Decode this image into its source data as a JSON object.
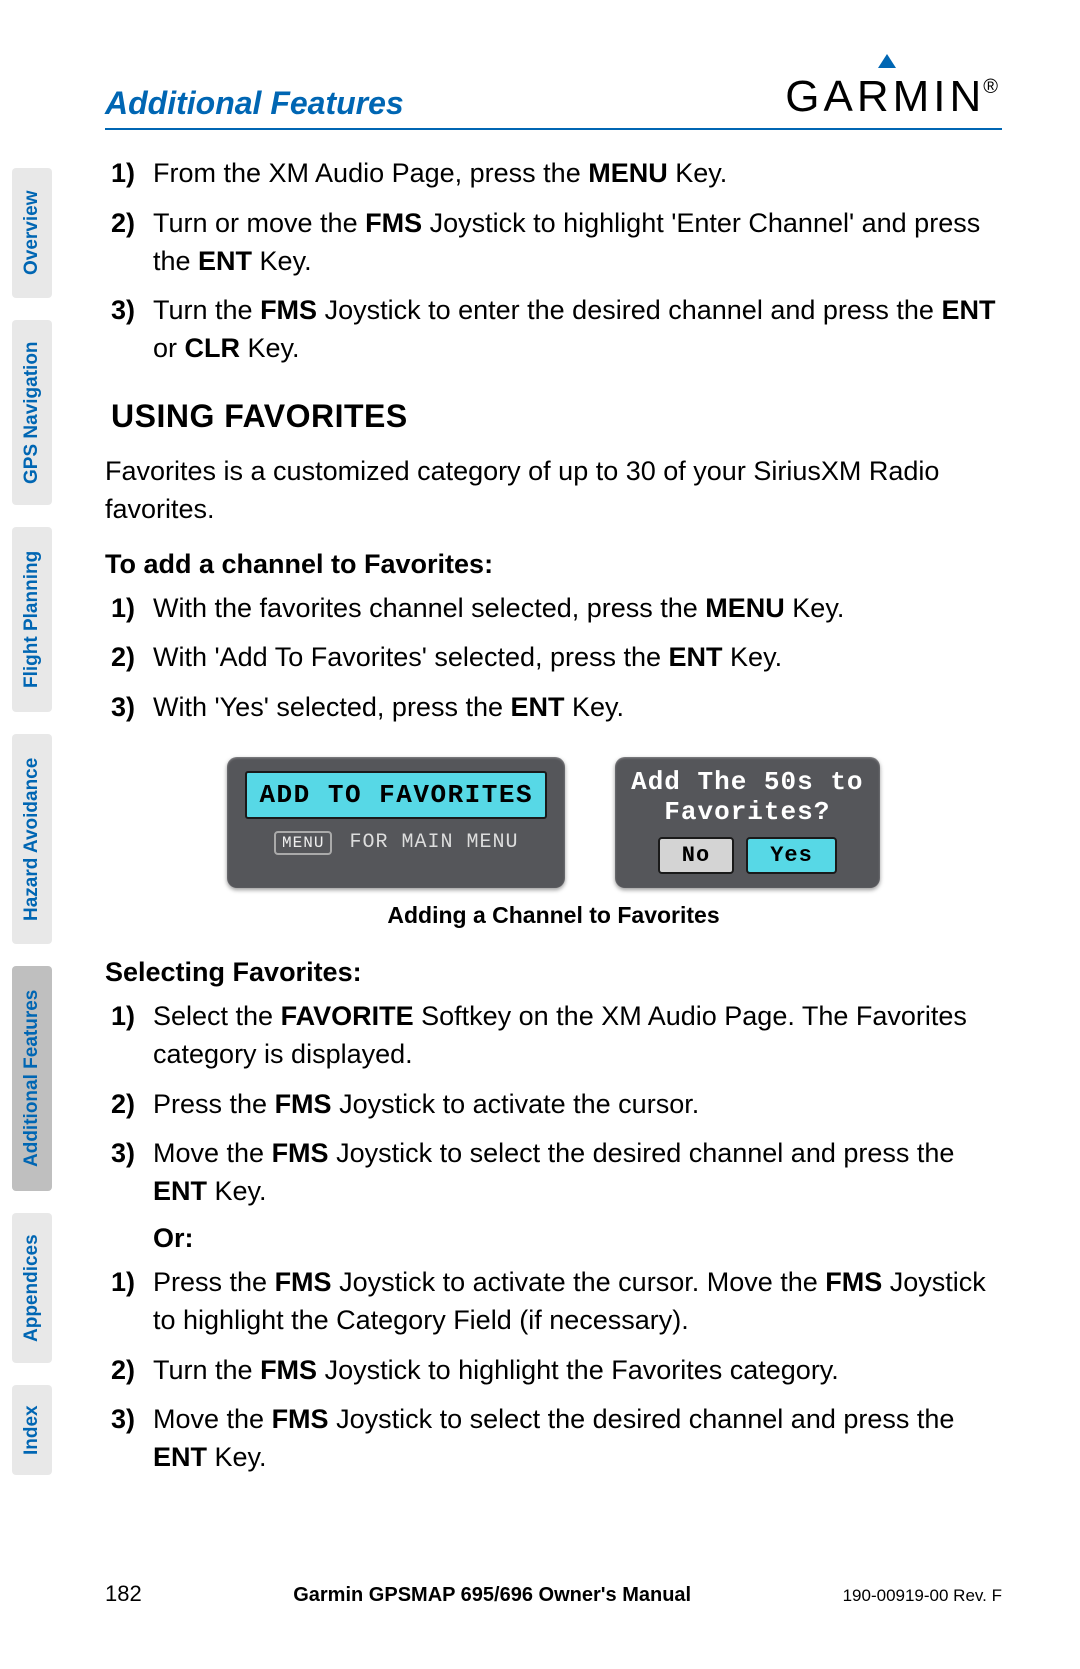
{
  "header": {
    "section_title": "Additional Features",
    "logo_text": "GARMIN"
  },
  "side_tabs": [
    {
      "label": "Overview",
      "active": false
    },
    {
      "label": "GPS Navigation",
      "active": false
    },
    {
      "label": "Flight Planning",
      "active": false
    },
    {
      "label": "Hazard Avoidance",
      "active": false
    },
    {
      "label": "Additional Features",
      "active": true
    },
    {
      "label": "Appendices",
      "active": false
    },
    {
      "label": "Index",
      "active": false
    }
  ],
  "intro_steps": [
    {
      "num": "1)",
      "text": "From the XM Audio Page, press the <b>MENU</b> Key."
    },
    {
      "num": "2)",
      "text": "Turn or move the <b>FMS</b> Joystick to highlight 'Enter Channel' and press the <b>ENT</b> Key."
    },
    {
      "num": "3)",
      "text": "Turn the <b>FMS</b> Joystick to enter the desired channel and press the <b>ENT</b> or <b>CLR</b> Key."
    }
  ],
  "heading_using_favorites": "USING FAVORITES",
  "favorites_intro": "Favorites is a customized category of up to 30 of your SiriusXM Radio favorites.",
  "subheading_add": "To add a channel to Favorites:",
  "add_steps": [
    {
      "num": "1)",
      "text": "With the favorites channel selected, press the <b>MENU</b> Key."
    },
    {
      "num": "2)",
      "text": "With 'Add To Favorites' selected, press the <b>ENT</b> Key."
    },
    {
      "num": "3)",
      "text": "With 'Yes' selected, press the <b>ENT</b> Key."
    }
  ],
  "figure": {
    "panel1_lcd": "Add To Favorites",
    "panel1_menu_prefix": "MENU",
    "panel1_menu_text": " for Main Menu",
    "panel2_title_l1": "Add The 50s to",
    "panel2_title_l2": "Favorites?",
    "panel2_no": "No",
    "panel2_yes": "Yes",
    "caption": "Adding a Channel to Favorites"
  },
  "subheading_select": "Selecting Favorites:",
  "select_steps_a": [
    {
      "num": "1)",
      "text": "Select the <b>FAVORITE</b> Softkey on the XM Audio Page.  The Favorites category is displayed."
    },
    {
      "num": "2)",
      "text": "Press the <b>FMS</b> Joystick to activate the cursor."
    },
    {
      "num": "3)",
      "text": "Move the <b>FMS</b> Joystick to select the desired channel and press the <b>ENT</b> Key."
    }
  ],
  "or_label": "Or:",
  "select_steps_b": [
    {
      "num": "1)",
      "text": "Press the <b>FMS</b> Joystick to activate the cursor.  Move the <b>FMS</b> Joystick to highlight the Category Field (if necessary)."
    },
    {
      "num": "2)",
      "text": "Turn the <b>FMS</b> Joystick to highlight the Favorites category."
    },
    {
      "num": "3)",
      "text": "Move the <b>FMS</b> Joystick to select the desired channel and press the <b>ENT</b> Key."
    }
  ],
  "footer": {
    "page": "182",
    "title": "Garmin GPSMAP 695/696 Owner's Manual",
    "rev": "190-00919-00  Rev. F"
  }
}
